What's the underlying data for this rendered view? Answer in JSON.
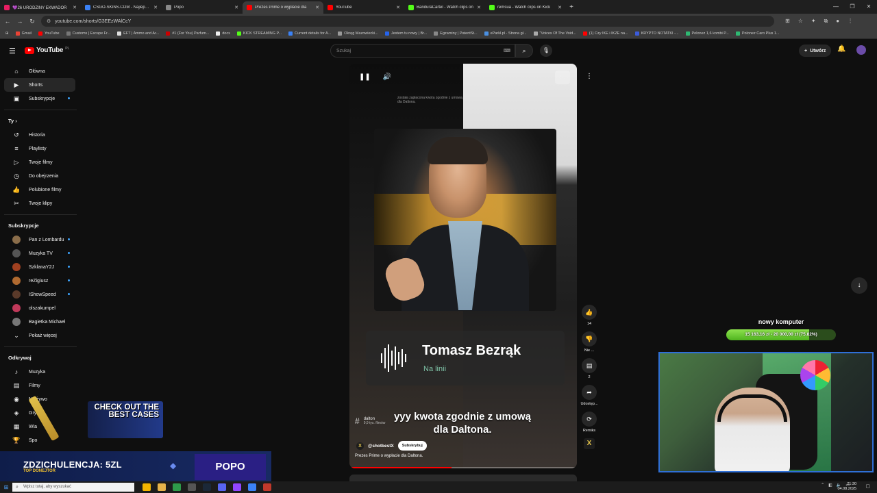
{
  "browser": {
    "tabs": [
      {
        "title": "💜26 URODZINY EKWADOR",
        "color": "#e91e63",
        "active": false
      },
      {
        "title": "CSGO-SKINS.COM - Najlepsze",
        "color": "#3b82f6",
        "active": false
      },
      {
        "title": "Popo",
        "color": "#888888",
        "active": false
      },
      {
        "title": "Prezes Prime o wypłacie dla",
        "color": "#ff0000",
        "active": true
      },
      {
        "title": "YouTube",
        "color": "#ff0000",
        "active": false
      },
      {
        "title": "BanduraCartel - Watch clips on",
        "color": "#53fc18",
        "active": false
      },
      {
        "title": "remsua - Watch clips on Kick",
        "color": "#53fc18",
        "active": false
      }
    ],
    "url": "youtube.com/shorts/G3EEzWAlCcY",
    "bookmarks": [
      "Gmail",
      "YouTube",
      "Customs | Escape Fr...",
      "EFT | Ammo and Ar...",
      "#1 (For You) Parfum...",
      "docs",
      "KICK STREAMING P...",
      "Current details for A...",
      "Okręg Mazowiecki...",
      "Jestem tu nowy | Br...",
      "Egzaminy | PatentSt...",
      "eParkl.pl - Strona gł...",
      "\"Voices Of The Void...",
      "(1) Czy IKE i IKZE na...",
      "KRYPTO NOTATKI -...",
      "Polonez 1,6 kombi P...",
      "Polonez Caro Plus 1..."
    ]
  },
  "header": {
    "logo_text": "YouTube",
    "region": "PL",
    "search_placeholder": "Szukaj",
    "create_label": "Utwórz"
  },
  "sidebar": {
    "main": [
      {
        "label": "Główna",
        "icon": "home-icon",
        "glyph": "⌂"
      },
      {
        "label": "Shorts",
        "icon": "shorts-icon",
        "glyph": "▶",
        "active": true
      },
      {
        "label": "Subskrypcje",
        "icon": "subscriptions-icon",
        "glyph": "▣",
        "dot": true
      }
    ],
    "you_title": "Ty",
    "you": [
      {
        "label": "Historia",
        "icon": "history-icon",
        "glyph": "↺"
      },
      {
        "label": "Playlisty",
        "icon": "playlists-icon",
        "glyph": "≡"
      },
      {
        "label": "Twoje filmy",
        "icon": "your-videos-icon",
        "glyph": "▷"
      },
      {
        "label": "Do obejrzenia",
        "icon": "watch-later-icon",
        "glyph": "◷"
      },
      {
        "label": "Polubione filmy",
        "icon": "liked-icon",
        "glyph": "👍"
      },
      {
        "label": "Twoje klipy",
        "icon": "clips-icon",
        "glyph": "✂"
      }
    ],
    "subs_title": "Subskrypcje",
    "subs": [
      {
        "label": "Pan z Lombardu",
        "color": "#8a6d4a",
        "dot": true
      },
      {
        "label": "Muzyka TV",
        "color": "#555555",
        "dot": true
      },
      {
        "label": "SzklanaY2J",
        "color": "#a04020",
        "dot": true
      },
      {
        "label": "reZigiusz",
        "color": "#b06a30",
        "dot": true
      },
      {
        "label": "IShowSpeed",
        "color": "#5a3a2a",
        "dot": true
      },
      {
        "label": "olszakumpel",
        "color": "#c0395a",
        "dot": false
      },
      {
        "label": "Bagietka Michael",
        "color": "#777777",
        "dot": false
      }
    ],
    "show_more": "Pokaż więcej",
    "explore_title": "Odkrywaj",
    "explore": [
      {
        "label": "Muzyka",
        "icon": "music-icon",
        "glyph": "♪"
      },
      {
        "label": "Filmy",
        "icon": "movies-icon",
        "glyph": "▤"
      },
      {
        "label": "Na żywo",
        "icon": "live-icon",
        "glyph": "◉"
      },
      {
        "label": "Gry",
        "icon": "gaming-icon",
        "glyph": "◈"
      },
      {
        "label": "Wia",
        "icon": "news-icon",
        "glyph": "▦"
      },
      {
        "label": "Spo",
        "icon": "sports-icon",
        "glyph": "🏆"
      },
      {
        "label": "Podcasty",
        "icon": "podcasts-icon",
        "glyph": "◎"
      }
    ]
  },
  "short": {
    "top_note": "została zapłacona kwota zgodnie z umową dla Daltona.",
    "caller_name": "Tomasz Bezrąk",
    "caller_status": "Na linii",
    "subtitle": "yyy kwota zgodnie z umową dla Daltona.",
    "hashtag": "dalton",
    "hashtag_count": "9,9 tys. filmów",
    "channel": "@shotbestX",
    "subscribe_label": "Subskrybuj",
    "title": "Prezes Prime o wypłacie dla Daltona.",
    "progress": 0.45,
    "likes": "14",
    "dislike_label": "Nie ...",
    "comments": "2",
    "share_label": "Udostęp...",
    "remix_label": "Remiks"
  },
  "overlay": {
    "goal_title": "nowy komputer",
    "goal_text": "15 163,16 zł - 20 000,00 zł (75.82%)",
    "goal_fraction": 0.7582,
    "promo_text": "CHECK OUT THE BEST CASES",
    "donor_line": "ZDZICHULENCJA: 5ZL",
    "donor_sub": "TOP DONEJTOR",
    "donor_name": "POPO"
  },
  "taskbar": {
    "search_placeholder": "Wpisz tutaj, aby wyszukać",
    "time": "21:30",
    "date": "04.08.2025"
  }
}
